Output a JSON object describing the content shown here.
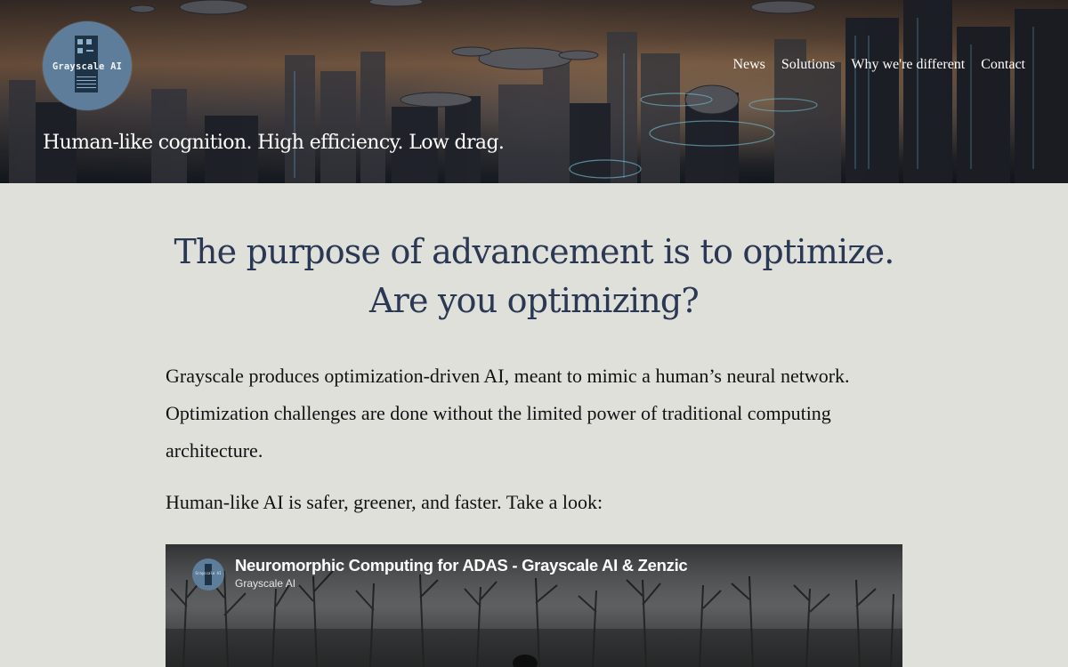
{
  "header": {
    "logo_text": "Grayscale AI",
    "tagline": "Human-like cognition. High efficiency. Low drag.",
    "nav": [
      {
        "label": "News"
      },
      {
        "label": "Solutions"
      },
      {
        "label": "Why we're different"
      },
      {
        "label": "Contact"
      }
    ]
  },
  "main": {
    "headline_line1": "The purpose of advancement is to optimize.",
    "headline_line2": "Are you optimizing?",
    "paragraph1": "Grayscale produces optimization-driven AI, meant to mimic a human’s neural network. Optimization challenges are done without the limited power of traditional computing architecture.",
    "paragraph2": "Human-like AI is safer, greener, and faster. Take a look:"
  },
  "video": {
    "title": "Neuromorphic Computing for ADAS - Grayscale AI & Zenzic",
    "channel": "Grayscale AI",
    "avatar_text": "Grayscale AI"
  },
  "colors": {
    "page_background": "#e0e0db",
    "headline": "#2a3854",
    "body_text": "#111111",
    "logo_circle": "#5e7d9a"
  }
}
